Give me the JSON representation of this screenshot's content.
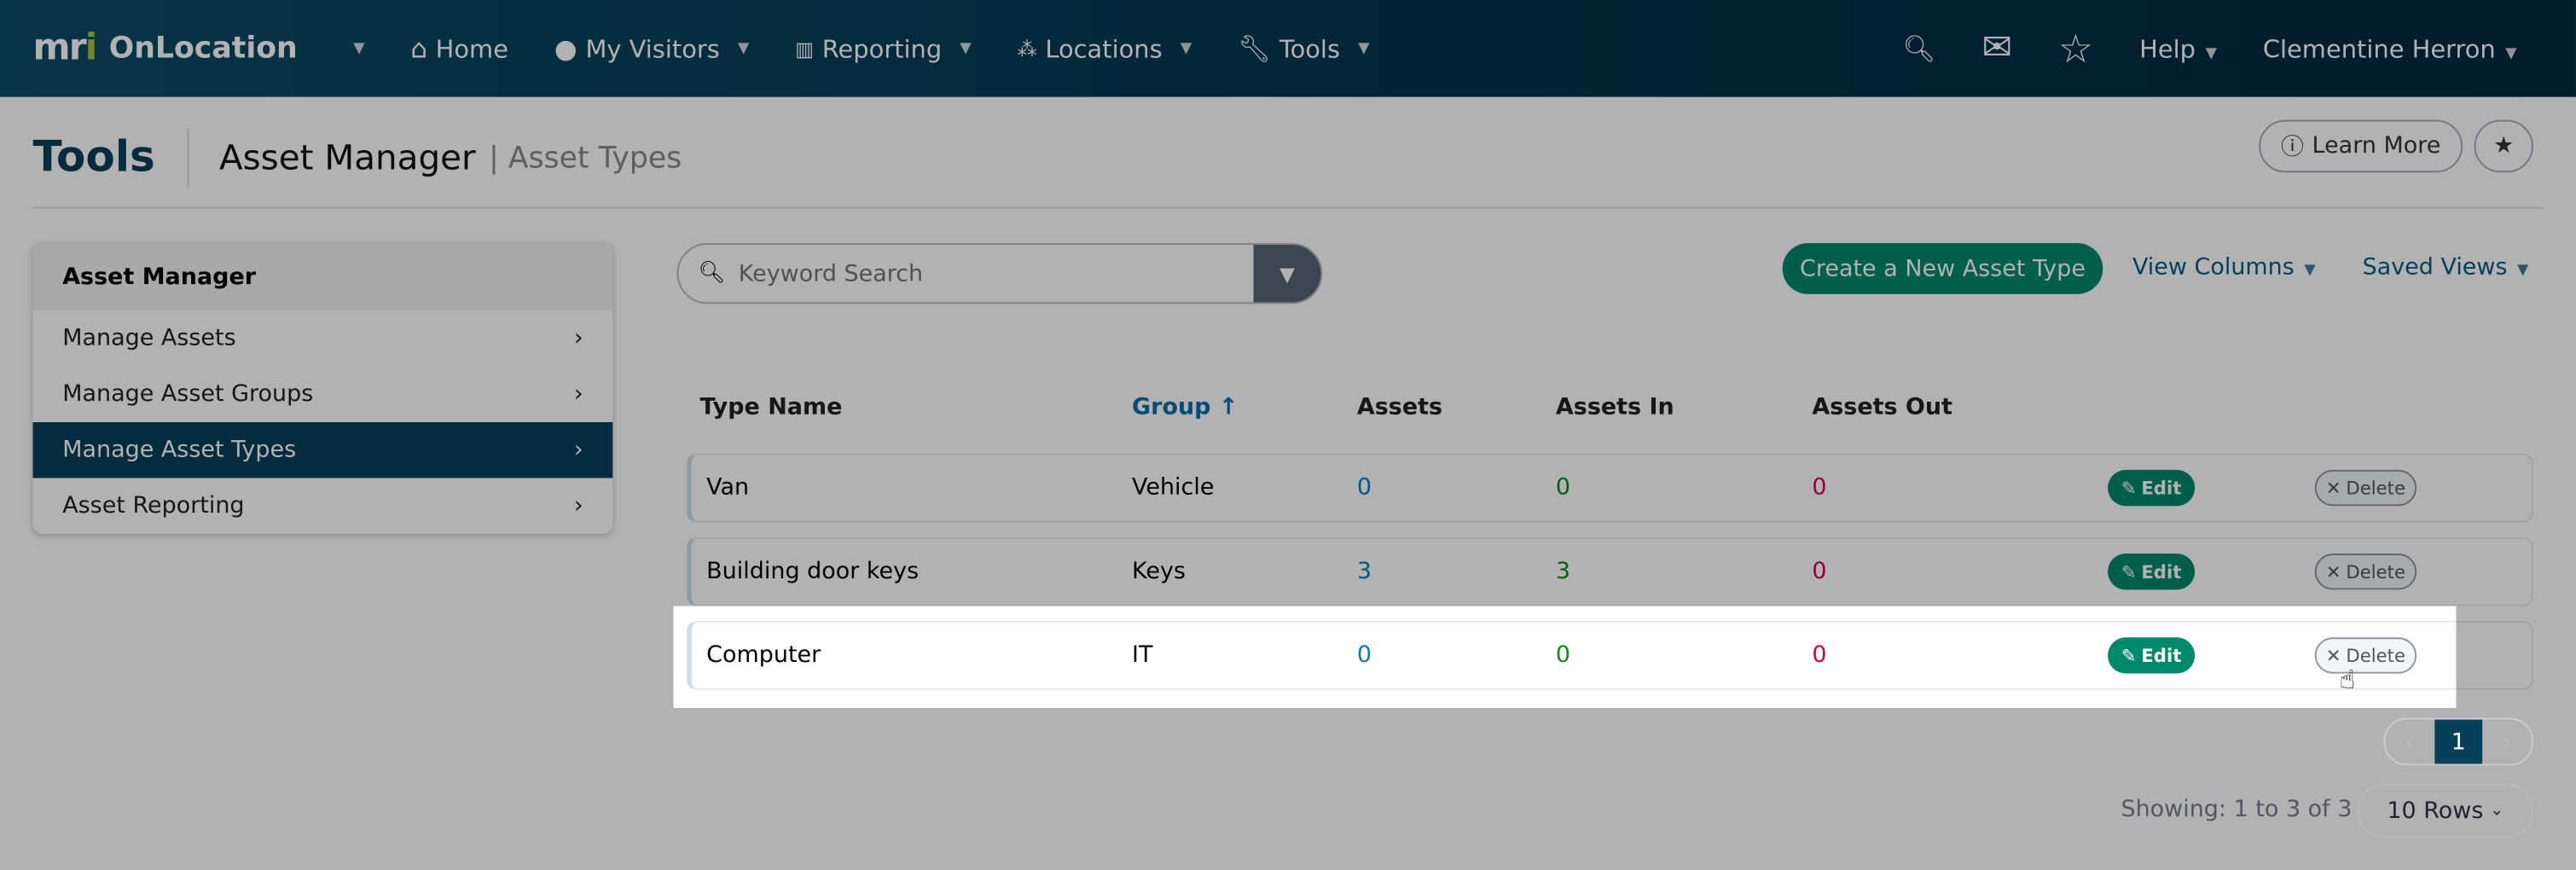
{
  "nav": {
    "brand": "mri",
    "app": "OnLocation",
    "items": [
      {
        "label": "Home",
        "icon": "home-icon"
      },
      {
        "label": "My Visitors",
        "icon": "user-icon"
      },
      {
        "label": "Reporting",
        "icon": "bar-chart-icon"
      },
      {
        "label": "Locations",
        "icon": "network-icon"
      },
      {
        "label": "Tools",
        "icon": "wrench-icon"
      }
    ],
    "help": "Help",
    "user": "Clementine Herron"
  },
  "header": {
    "title": "Tools",
    "section": "Asset Manager",
    "subsection": "| Asset Types",
    "learn_more": "Learn More"
  },
  "sidebar": {
    "title": "Asset Manager",
    "items": [
      {
        "label": "Manage Assets"
      },
      {
        "label": "Manage Asset Groups"
      },
      {
        "label": "Manage Asset Types",
        "active": true
      },
      {
        "label": "Asset Reporting"
      }
    ]
  },
  "toolbar": {
    "search_placeholder": "Keyword Search",
    "create": "Create a New Asset Type",
    "view_columns": "View Columns",
    "saved_views": "Saved Views"
  },
  "table": {
    "columns": [
      "Type Name",
      "Group ↑",
      "Assets",
      "Assets In",
      "Assets Out"
    ],
    "rows": [
      {
        "name": "Van",
        "group": "Vehicle",
        "assets": "0",
        "in": "0",
        "out": "0"
      },
      {
        "name": "Building door keys",
        "group": "Keys",
        "assets": "3",
        "in": "3",
        "out": "0"
      },
      {
        "name": "Computer",
        "group": "IT",
        "assets": "0",
        "in": "0",
        "out": "0"
      }
    ],
    "edit": "Edit",
    "delete": "Delete"
  },
  "pagination": {
    "page": "1",
    "showing": "Showing: 1 to 3 of 3",
    "rows": "10 Rows"
  },
  "colors": {
    "brand": "#07405a",
    "accent": "#00896a",
    "assets": "#0a7bc2",
    "in": "#118a1e",
    "out": "#d4004f"
  }
}
